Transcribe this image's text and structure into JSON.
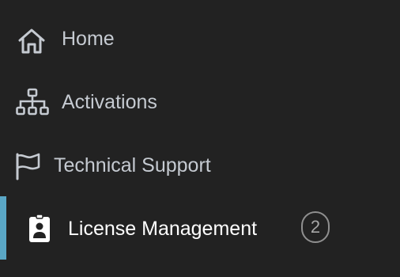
{
  "sidebar": {
    "items": [
      {
        "label": "Home",
        "icon": "home-icon",
        "active": false
      },
      {
        "label": "Activations",
        "icon": "sitemap-icon",
        "active": false
      },
      {
        "label": "Technical Support",
        "icon": "flag-icon",
        "active": false
      },
      {
        "label": "License Management",
        "icon": "id-badge-icon",
        "active": true,
        "badge": "2"
      }
    ]
  },
  "colors": {
    "background": "#222222",
    "text": "#c5cad1",
    "active_text": "#ffffff",
    "active_indicator": "#5aa7c6",
    "badge_border": "#8f8f8f"
  }
}
